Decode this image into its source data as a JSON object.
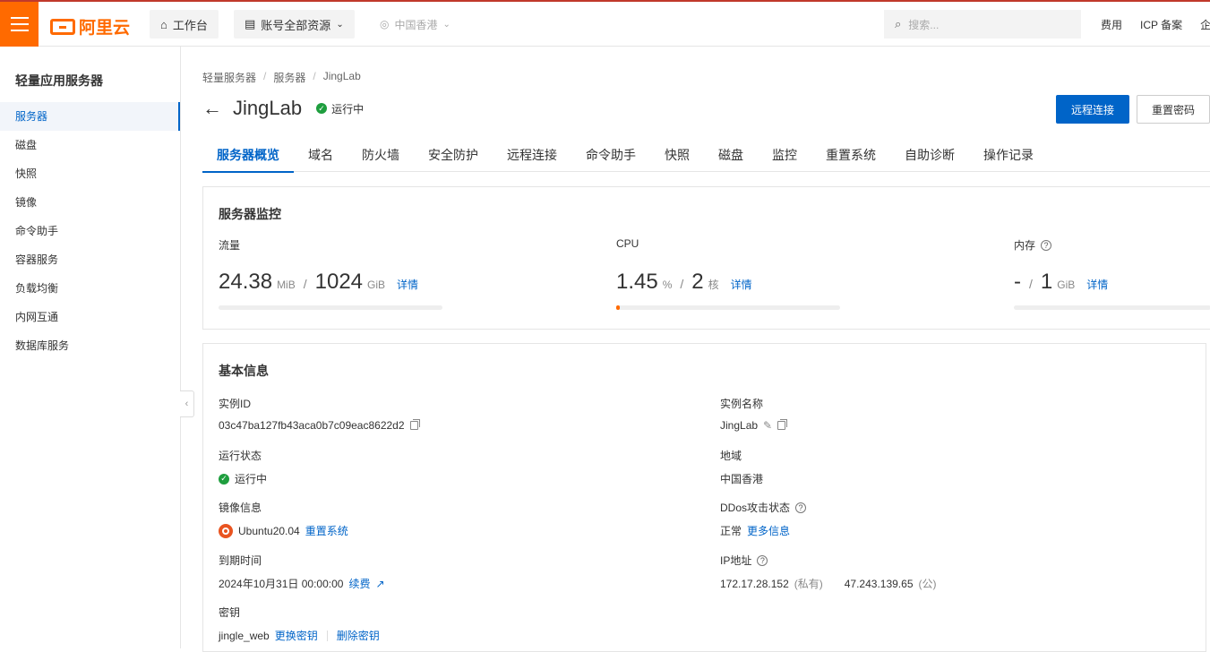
{
  "topbar": {
    "logo_text": "阿里云",
    "workbench": "工作台",
    "resources": "账号全部资源",
    "region": "中国香港",
    "search_placeholder": "搜索...",
    "links": [
      "费用",
      "ICP 备案",
      "企"
    ]
  },
  "sidebar": {
    "title": "轻量应用服务器",
    "items": [
      {
        "label": "服务器",
        "active": true
      },
      {
        "label": "磁盘"
      },
      {
        "label": "快照"
      },
      {
        "label": "镜像"
      },
      {
        "label": "命令助手"
      },
      {
        "label": "容器服务"
      },
      {
        "label": "负载均衡"
      },
      {
        "label": "内网互通"
      },
      {
        "label": "数据库服务"
      }
    ]
  },
  "breadcrumb": [
    "轻量服务器",
    "服务器",
    "JingLab"
  ],
  "header": {
    "title": "JingLab",
    "status": "运行中",
    "remote_button": "远程连接",
    "reset_password_button": "重置密码"
  },
  "tabs": [
    "服务器概览",
    "域名",
    "防火墙",
    "安全防护",
    "远程连接",
    "命令助手",
    "快照",
    "磁盘",
    "监控",
    "重置系统",
    "自助诊断",
    "操作记录"
  ],
  "monitor": {
    "title": "服务器监控",
    "traffic": {
      "label": "流量",
      "used": "24.38",
      "used_unit": "MiB",
      "total": "1024",
      "total_unit": "GiB",
      "detail": "详情",
      "usage_fraction": 0.0
    },
    "cpu": {
      "label": "CPU",
      "used": "1.45",
      "used_unit": "%",
      "total": "2",
      "total_unit": "核",
      "detail": "详情",
      "usage_fraction": 0.0145
    },
    "memory": {
      "label": "内存",
      "used": "-",
      "total": "1",
      "total_unit": "GiB",
      "detail": "详情",
      "usage_fraction": 0.0
    }
  },
  "basic": {
    "title": "基本信息",
    "instance_id_label": "实例ID",
    "instance_id": "03c47ba127fb43aca0b7c09eac8622d2",
    "instance_name_label": "实例名称",
    "instance_name": "JingLab",
    "run_status_label": "运行状态",
    "run_status": "运行中",
    "region_label": "地域",
    "region": "中国香港",
    "image_label": "镜像信息",
    "image": "Ubuntu20.04",
    "reset_system": "重置系统",
    "ddos_label": "DDos攻击状态",
    "ddos_status": "正常",
    "ddos_more": "更多信息",
    "expire_label": "到期时间",
    "expire": "2024年10月31日 00:00:00",
    "renew": "续费",
    "ip_label": "IP地址",
    "private_ip": "172.17.28.152",
    "private_tag": "(私有)",
    "public_ip": "47.243.139.65",
    "public_tag": "(公)",
    "key_label": "密钥",
    "key_name": "jingle_web",
    "change_key": "更换密钥",
    "delete_key": "删除密钥"
  }
}
